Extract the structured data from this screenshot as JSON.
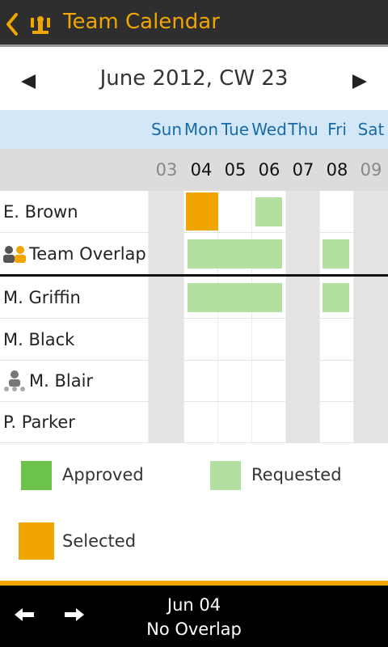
{
  "header": {
    "title": "Team Calendar"
  },
  "period": {
    "label": "June 2012, CW 23"
  },
  "days": [
    "Sun",
    "Mon",
    "Tue",
    "Wed",
    "Thu",
    "Fri",
    "Sat"
  ],
  "dates": [
    "03",
    "04",
    "05",
    "06",
    "07",
    "08",
    "09"
  ],
  "rows": [
    {
      "name": "E. Brown"
    },
    {
      "name": "Team Overlap"
    },
    {
      "name": "M. Griffin"
    },
    {
      "name": "M. Black"
    },
    {
      "name": "M. Blair"
    },
    {
      "name": "P. Parker"
    }
  ],
  "legend": {
    "approved": "Approved",
    "requested": "Requested",
    "selected": "Selected"
  },
  "colors": {
    "approved": "#6cc24a",
    "requested": "#b3dfa0",
    "selected": "#f0a500",
    "weekend": "#e3e3e3",
    "accent": "#f0a500"
  },
  "status": {
    "date": "Jun 04",
    "overlap": "No Overlap"
  }
}
